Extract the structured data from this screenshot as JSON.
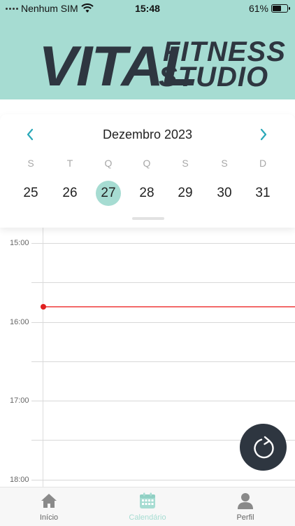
{
  "status_bar": {
    "carrier": "Nenhum SIM",
    "time": "15:48",
    "battery": "61%",
    "battery_level": 0.61
  },
  "header": {
    "logo_main": "VITAL",
    "logo_line1": "FITNESS",
    "logo_line2": "STUDIO"
  },
  "calendar": {
    "month": "Dezembro 2023",
    "weekdays": [
      "S",
      "T",
      "Q",
      "Q",
      "S",
      "S",
      "D"
    ],
    "days": [
      "25",
      "26",
      "27",
      "28",
      "29",
      "30",
      "31"
    ],
    "selected_day": "27"
  },
  "timeline": {
    "hours": [
      "15:00",
      "16:00",
      "17:00",
      "18:00"
    ]
  },
  "tabbar": {
    "items": [
      {
        "label": "Início",
        "icon": "home-icon"
      },
      {
        "label": "Calendário",
        "icon": "calendar-icon"
      },
      {
        "label": "Perfil",
        "icon": "user-icon"
      }
    ],
    "active": "Calendário"
  },
  "colors": {
    "brand": "#a6dcd2",
    "dark": "#2e3640",
    "accent": "#2aa8b8",
    "now_line": "#f26a6a"
  }
}
